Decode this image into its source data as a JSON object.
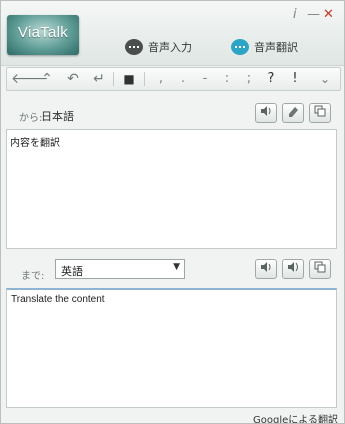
{
  "app": {
    "logo_text": "ViaTalk"
  },
  "window_controls": {
    "info": "i",
    "minimize": "—",
    "close": "✕"
  },
  "voice": {
    "input_label": "音声入力",
    "translate_label": "音声翻訳"
  },
  "toolbar": {
    "back_icon": "🡐",
    "up_icon": "⌃",
    "undo_icon": "↶",
    "enter_icon": "↵",
    "panel_icon": "■",
    "punctuation": [
      ",",
      ".",
      "-",
      ":",
      ";",
      "?",
      "!"
    ],
    "more_icon": "⌄"
  },
  "source": {
    "prefix": "から:",
    "language": "日本語",
    "text": "内容を翻訳"
  },
  "target": {
    "prefix": "まで:",
    "language": "英語",
    "text": "Translate the content"
  },
  "footer": {
    "credit": "Googleによる翻訳"
  }
}
